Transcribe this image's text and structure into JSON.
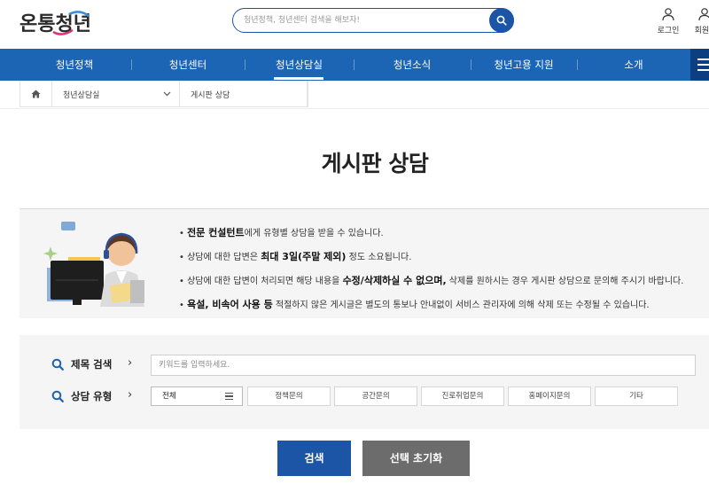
{
  "header": {
    "logo_text": "온통청년",
    "search_placeholder": "청년정책, 청년센터 검색을 해보자!",
    "login_label": "로그인",
    "join_label": "회원가"
  },
  "gnb": {
    "items": [
      "청년정책",
      "청년센터",
      "청년상담실",
      "청년소식",
      "청년고용 지원",
      "소개"
    ],
    "active_index": 2
  },
  "breadcrumb": {
    "level1": "청년상담실",
    "level2": "게시판 상담"
  },
  "page_title": "게시판 상담",
  "info": {
    "bullets": [
      {
        "prefix": "• ",
        "bold": "전문 컨설턴트",
        "rest": "에게 유형별 상담을 받을 수 있습니다."
      },
      {
        "prefix": "• 상담에 대한 답변은 ",
        "bold": "최대 3일(주말 제외)",
        "rest": " 정도 소요됩니다."
      },
      {
        "prefix": "• 상담에 대한 답변이 처리되면 해당 내용을 ",
        "bold": "수정/삭제하실 수 없으며,",
        "rest": " 삭제를 원하시는 경우 게시판 상담으로 문의해 주시기 바랍니다."
      },
      {
        "prefix": "• ",
        "bold": "욕설, 비속어 사용 등",
        "rest": " 적절하지 않은 게시글은 별도의 통보나 안내없이 서비스 관리자에 의해 삭제 또는 수정될 수 있습니다."
      }
    ]
  },
  "filter": {
    "title_search_label": "제목 검색",
    "keyword_placeholder": "키워드를 입력하세요.",
    "type_label": "상담 유형",
    "type_selected": "전체",
    "type_options": [
      "정책문의",
      "공간문의",
      "진로취업문의",
      "홈페이지문의",
      "기타"
    ]
  },
  "buttons": {
    "search": "검색",
    "reset": "선택 초기화"
  },
  "colors": {
    "primary": "#1c55a6",
    "nav": "#1c64b4",
    "reset_button": "#6c6c6c"
  }
}
